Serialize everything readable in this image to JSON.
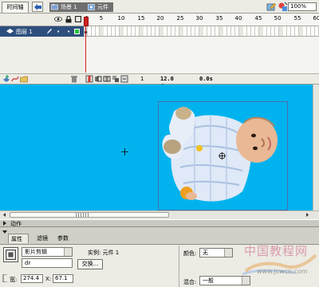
{
  "tabs": {
    "timeline": "时间轴"
  },
  "breadcrumb": {
    "scene": "场景 1",
    "symbol": "元件 2"
  },
  "zoom": "100%",
  "ruler": {
    "ticks": [
      "1",
      "5",
      "10",
      "15",
      "20",
      "25",
      "30",
      "35",
      "40",
      "45",
      "50",
      "55",
      "60"
    ]
  },
  "layer": {
    "name": "图层 1"
  },
  "timeline_bar": {
    "frame": "1",
    "fps": "12.0 fps",
    "time": "0.0s"
  },
  "panels": {
    "actions": "动作",
    "properties": "属性",
    "filters": "滤镜",
    "parameters": "参数"
  },
  "props": {
    "symbol_type": "影片剪辑",
    "instance_label": "实例: 元件 1",
    "instance_name": "dr",
    "swap_button": "交换...",
    "width_label": "宽:",
    "width_value": "274.4",
    "x_label": "X:",
    "x_value": "67.1",
    "color_label": "颜色:",
    "color_value": "无",
    "blend_label": "混合:",
    "blend_value": "一般"
  },
  "watermark": {
    "text": "中国教程网",
    "url": "www.jcwcn.com"
  },
  "colors": {
    "stage": "#00b3ee",
    "layer_selected": "#2e4f7e",
    "playhead": "#cc2222"
  }
}
